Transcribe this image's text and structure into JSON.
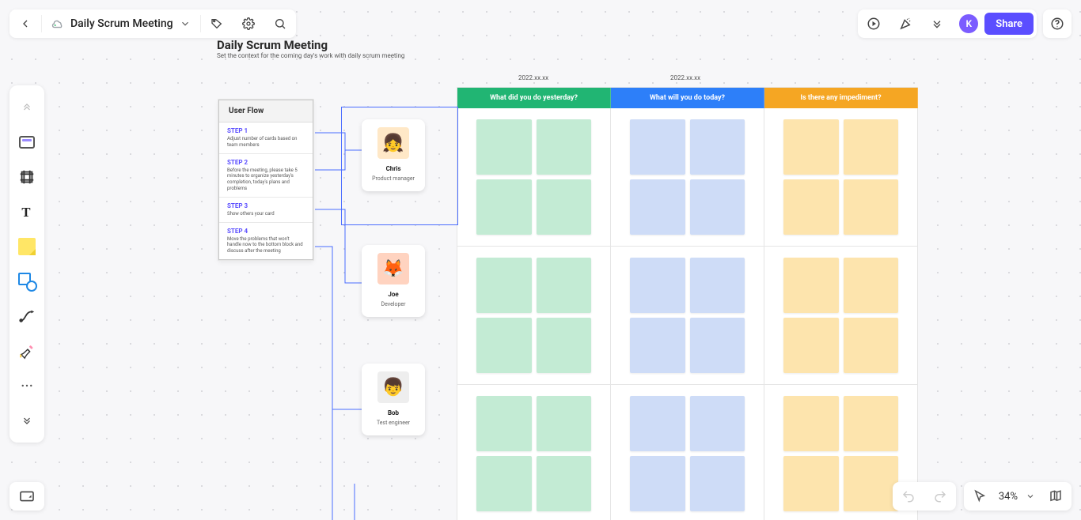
{
  "header": {
    "doc_title": "Daily Scrum Meeting",
    "share_label": "Share",
    "avatar_initial": "K"
  },
  "board": {
    "title": "Daily Scrum Meeting",
    "subtitle": "Set the context for the coming day's work with daily scrum meeting"
  },
  "userflow": {
    "title": "User Flow",
    "steps": [
      {
        "label": "STEP 1",
        "desc": "Adjust number of cards based on team members"
      },
      {
        "label": "STEP 2",
        "desc": "Before the meeting, please take 5 minutes to organize yesterday's completion, today's plans and problems"
      },
      {
        "label": "STEP 3",
        "desc": "Show others your card"
      },
      {
        "label": "STEP 4",
        "desc": "Move the problems that won't handle now to the bottom block and discuss after the meeting"
      }
    ]
  },
  "members": [
    {
      "name": "Chris",
      "role": "Product manager",
      "emoji": "👧"
    },
    {
      "name": "Joe",
      "role": "Developer",
      "emoji": "🦊"
    },
    {
      "name": "Bob",
      "role": "Test engineer",
      "emoji": "👦"
    }
  ],
  "dates": {
    "left": "2022.xx.xx",
    "right": "2022.xx.xx"
  },
  "columns": {
    "yesterday": "What did you do yesterday?",
    "today": "What will you do today?",
    "impediment": "Is there any impediment?"
  },
  "zoom": {
    "label": "34%"
  }
}
